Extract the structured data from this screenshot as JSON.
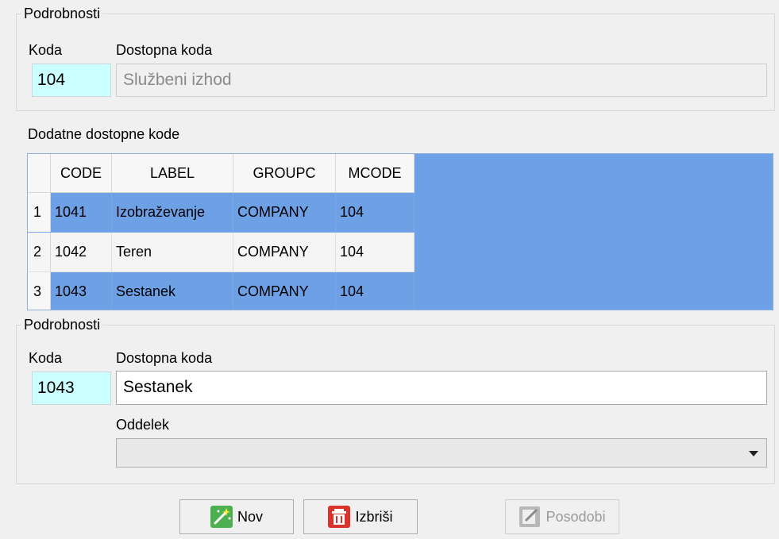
{
  "top_group": {
    "legend": "Podrobnosti",
    "code_label": "Koda",
    "desc_label": "Dostopna koda",
    "code_value": "104",
    "desc_value": "Službeni izhod"
  },
  "sub_codes": {
    "legend": "Dodatne dostopne kode",
    "columns": [
      "CODE",
      "LABEL",
      "GROUPC",
      "MCODE"
    ],
    "rows": [
      {
        "num": "1",
        "code": "1041",
        "label": "Izobraževanje",
        "group": "COMPANY",
        "mcode": "104"
      },
      {
        "num": "2",
        "code": "1042",
        "label": "Teren",
        "group": "COMPANY",
        "mcode": "104"
      },
      {
        "num": "3",
        "code": "1043",
        "label": "Sestanek",
        "group": "COMPANY",
        "mcode": "104"
      }
    ]
  },
  "bottom_group": {
    "legend": "Podrobnosti",
    "code_label": "Koda",
    "desc_label": "Dostopna koda",
    "code_value": "1043",
    "desc_value": "Sestanek",
    "dept_label": "Oddelek",
    "dept_value": ""
  },
  "buttons": {
    "new": "Nov",
    "delete": "Izbriši",
    "update": "Posodobi"
  },
  "colors": {
    "selection": "#6ea0e6",
    "code_field": "#ccffff"
  },
  "icons": {
    "new": "magic-wand-icon",
    "delete": "trash-icon",
    "update": "edit-icon"
  }
}
